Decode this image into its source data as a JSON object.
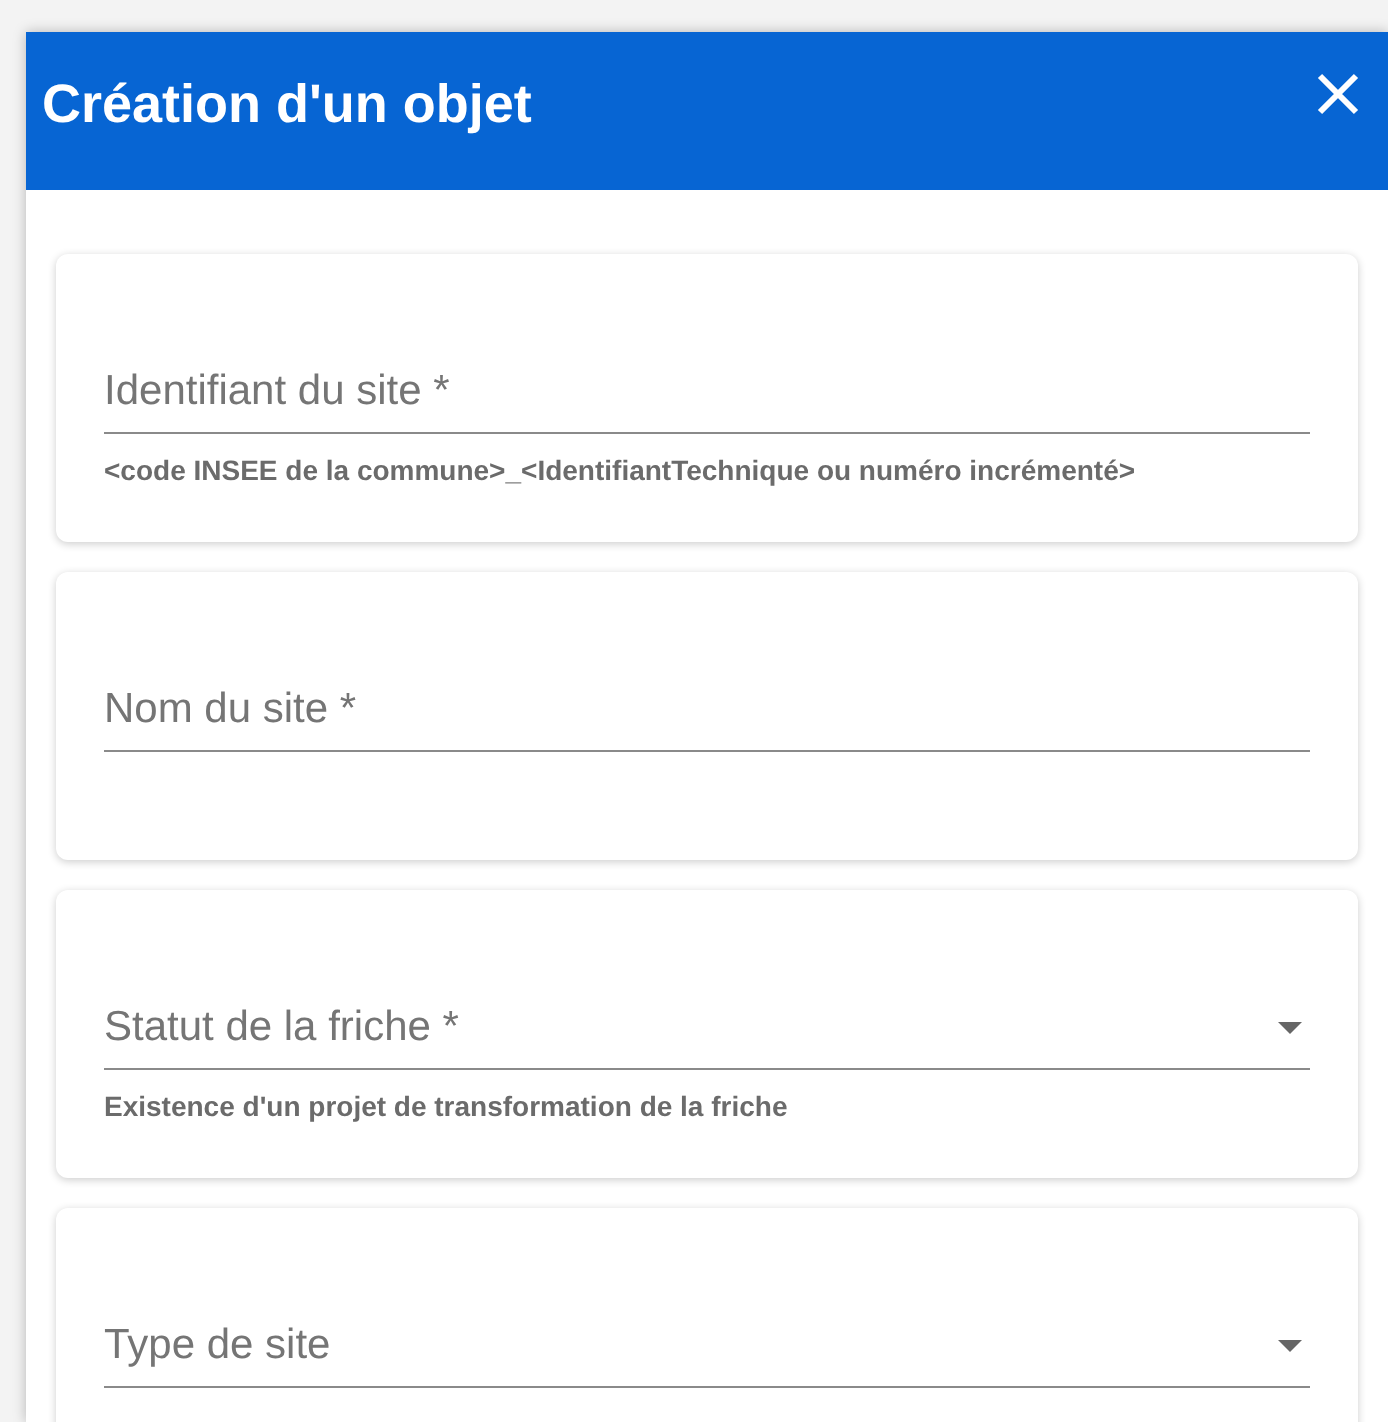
{
  "dialog": {
    "title": "Création d'un objet"
  },
  "fields": [
    {
      "kind": "text",
      "label": "Identifiant du site *",
      "helper": "<code INSEE de la commune>_<IdentifiantTechnique ou numéro incrémenté>"
    },
    {
      "kind": "text",
      "label": "Nom du site *"
    },
    {
      "kind": "select",
      "label": "Statut de la friche *",
      "helper": "Existence d'un projet de transformation de la friche"
    },
    {
      "kind": "select",
      "label": "Type de site"
    }
  ]
}
